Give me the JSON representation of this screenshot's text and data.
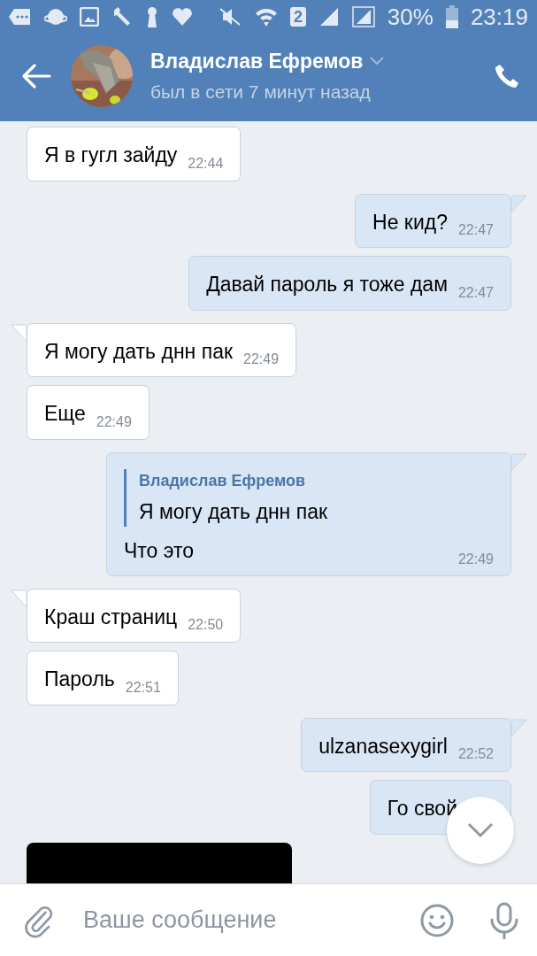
{
  "status_bar": {
    "sim_slot": "2",
    "battery": "30%",
    "time": "23:19"
  },
  "header": {
    "name": "Владислав Ефремов",
    "status": "был в сети 7 минут назад"
  },
  "messages": [
    {
      "kind": "text",
      "outgoing": false,
      "tail": false,
      "text": "Я в гугл зайду",
      "time": "22:44"
    },
    {
      "kind": "text",
      "outgoing": true,
      "tail": true,
      "text": "Не кид?",
      "time": "22:47"
    },
    {
      "kind": "text",
      "outgoing": true,
      "tail": false,
      "text": "Давай пароль я тоже дам",
      "time": "22:47"
    },
    {
      "kind": "text",
      "outgoing": false,
      "tail": true,
      "text": "Я могу дать днн пак",
      "time": "22:49"
    },
    {
      "kind": "text",
      "outgoing": false,
      "tail": false,
      "text": "Еще",
      "time": "22:49"
    },
    {
      "kind": "reply",
      "outgoing": true,
      "tail": true,
      "reply": {
        "author": "Владислав Ефремов",
        "text": "Я могу дать днн пак"
      },
      "text": "Что это",
      "time": "22:49"
    },
    {
      "kind": "text",
      "outgoing": false,
      "tail": true,
      "text": "Краш страниц",
      "time": "22:50"
    },
    {
      "kind": "text",
      "outgoing": false,
      "tail": false,
      "text": "Пароль",
      "time": "22:51"
    },
    {
      "kind": "text",
      "outgoing": true,
      "tail": true,
      "text": "ulzanasexygirl",
      "time": "22:52"
    },
    {
      "kind": "text",
      "outgoing": true,
      "tail": false,
      "text": "Го свой"
    },
    {
      "kind": "redacted",
      "outgoing": false,
      "tail": false
    }
  ],
  "composer": {
    "placeholder": "Ваше сообщение"
  }
}
